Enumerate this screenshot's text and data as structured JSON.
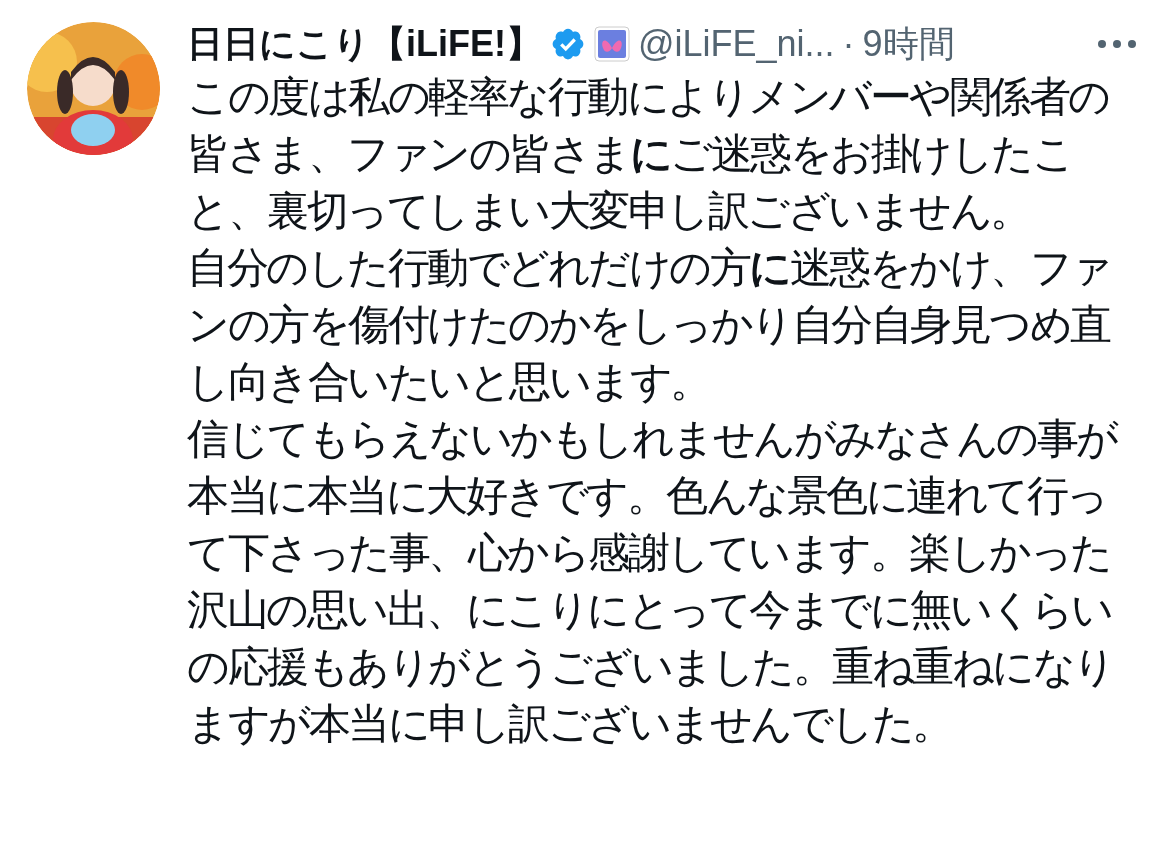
{
  "tweet": {
    "author_name": "日日にこり【iLiFE!】",
    "verified": true,
    "handle": "@iLiFE_ni...",
    "separator": "·",
    "time": "9時間",
    "paragraphs": [
      "この度は私の軽率な行動によりメンバーや関係者の皆さま、ファンの皆さま**に**ご迷惑をお掛けしたこと、裏切ってしまい大変申し訳ございません。",
      "自分のした行動でどれだけの方**に**迷惑をかけ、ファンの方を傷付けたのかをしっかり自分自身見つめ直し向き合いたいと思います。",
      "信じてもらえないかもしれませんがみなさんの事が本当に本当に大好きです。色んな景色に連れて行って下さった事、心から感謝しています。楽しかった沢山の思い出、にこりにとって今までに無いくらいの応援もありがとうございました。重ね重ねになりますが本当に申し訳ございませんでした。"
    ]
  }
}
